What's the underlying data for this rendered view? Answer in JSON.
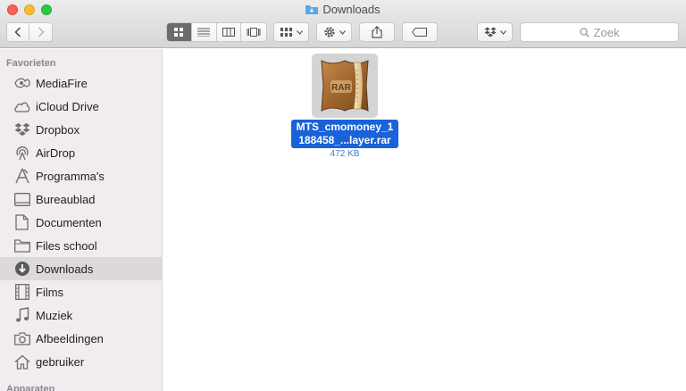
{
  "window": {
    "title": "Downloads"
  },
  "toolbar": {
    "search_placeholder": "Zoek"
  },
  "sidebar": {
    "favorites_title": "Favorieten",
    "devices_title": "Apparaten",
    "items": [
      {
        "label": "MediaFire",
        "icon": "mediafire-icon"
      },
      {
        "label": "iCloud Drive",
        "icon": "cloud-icon"
      },
      {
        "label": "Dropbox",
        "icon": "dropbox-icon"
      },
      {
        "label": "AirDrop",
        "icon": "airdrop-icon"
      },
      {
        "label": "Programma's",
        "icon": "applications-icon"
      },
      {
        "label": "Bureaublad",
        "icon": "desktop-icon"
      },
      {
        "label": "Documenten",
        "icon": "document-icon"
      },
      {
        "label": "Files school",
        "icon": "folder-icon"
      },
      {
        "label": "Downloads",
        "icon": "download-icon",
        "selected": true
      },
      {
        "label": "Films",
        "icon": "film-icon"
      },
      {
        "label": "Muziek",
        "icon": "music-icon"
      },
      {
        "label": "Afbeeldingen",
        "icon": "camera-icon"
      },
      {
        "label": "gebruiker",
        "icon": "home-icon"
      }
    ]
  },
  "files": [
    {
      "name_line1": "MTS_cmomoney_1",
      "name_line2": "188458_...layer.rar",
      "size": "472 KB",
      "thumb_label": "RAR"
    }
  ],
  "colors": {
    "selection": "#1a62d8",
    "sidebar_bg": "#f0ecf0"
  }
}
